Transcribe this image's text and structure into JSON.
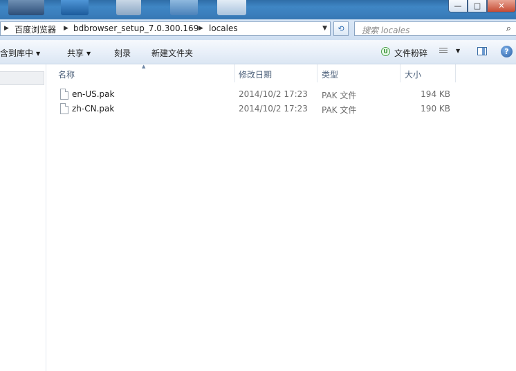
{
  "window": {
    "minimize_glyph": "—",
    "maximize_glyph": "□",
    "close_glyph": "✕"
  },
  "address": {
    "breadcrumbs": [
      "百度浏览器",
      "bdbrowser_setup_7.0.300.169",
      "locales"
    ],
    "search_placeholder": "搜索 locales"
  },
  "toolbar": {
    "include_library": "包含到库中",
    "share": "共享",
    "burn": "刻录",
    "new_folder": "新建文件夹",
    "file_shred": "文件粉碎",
    "help": "?"
  },
  "columns": {
    "name": "名称",
    "date": "修改日期",
    "type": "类型",
    "size": "大小"
  },
  "files": [
    {
      "name": "en-US.pak",
      "date": "2014/10/2 17:23",
      "type": "PAK 文件",
      "size": "194 KB"
    },
    {
      "name": "zh-CN.pak",
      "date": "2014/10/2 17:23",
      "type": "PAK 文件",
      "size": "190 KB"
    }
  ],
  "colors": {
    "titlebar": "#3b7fbd",
    "header_text": "#4c607a",
    "meta_text": "#6d6d6d"
  },
  "icons": {
    "refresh": "refresh-icon",
    "search": "search-icon",
    "file": "file-icon",
    "view": "view-options-icon",
    "preview_pane": "preview-pane-icon",
    "help": "help-icon"
  }
}
